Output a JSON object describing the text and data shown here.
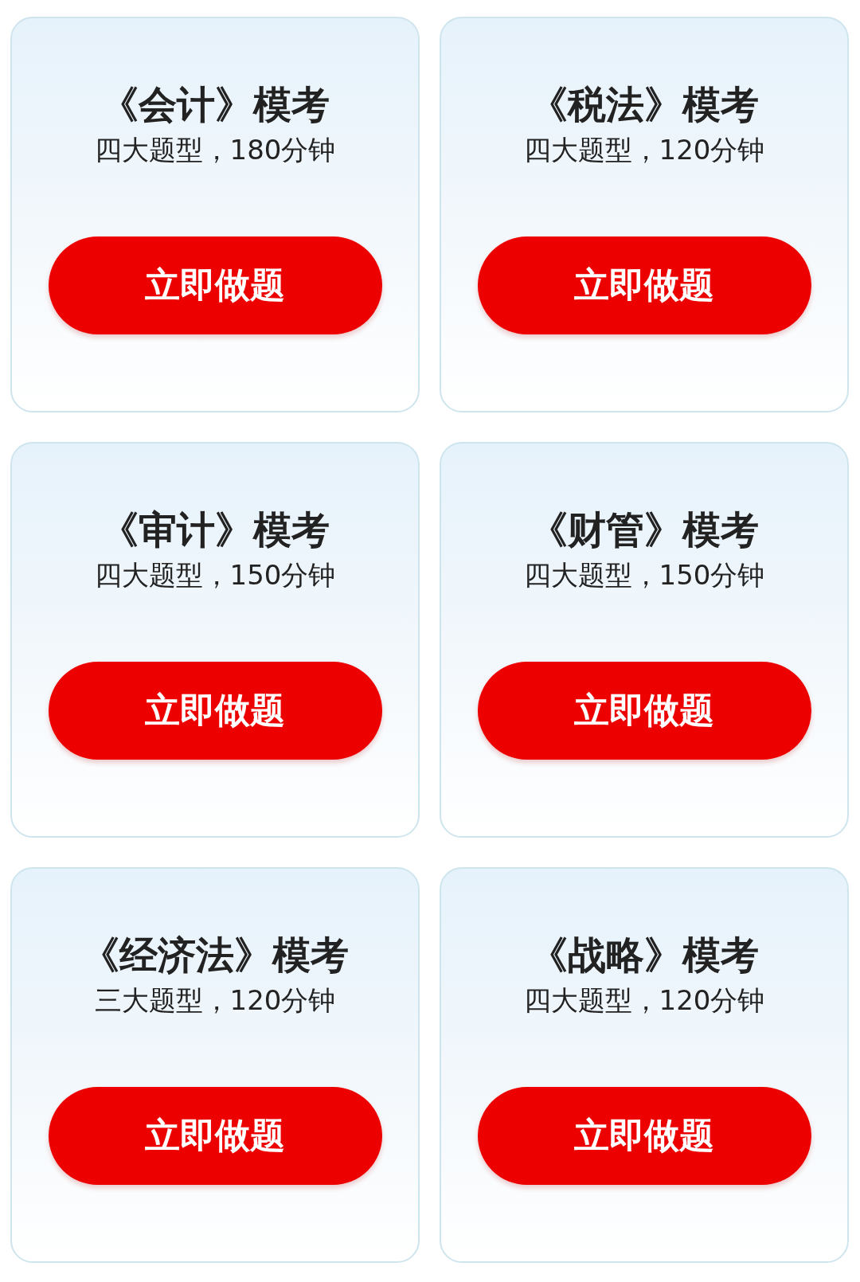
{
  "cards": [
    {
      "title": "《会计》模考",
      "subtitle": "四大题型，180分钟",
      "button": "立即做题"
    },
    {
      "title": "《税法》模考",
      "subtitle": "四大题型，120分钟",
      "button": "立即做题"
    },
    {
      "title": "《审计》模考",
      "subtitle": "四大题型，150分钟",
      "button": "立即做题"
    },
    {
      "title": "《财管》模考",
      "subtitle": "四大题型，150分钟",
      "button": "立即做题"
    },
    {
      "title": "《经济法》模考",
      "subtitle": "三大题型，120分钟",
      "button": "立即做题"
    },
    {
      "title": "《战略》模考",
      "subtitle": "四大题型，120分钟",
      "button": "立即做题"
    }
  ]
}
